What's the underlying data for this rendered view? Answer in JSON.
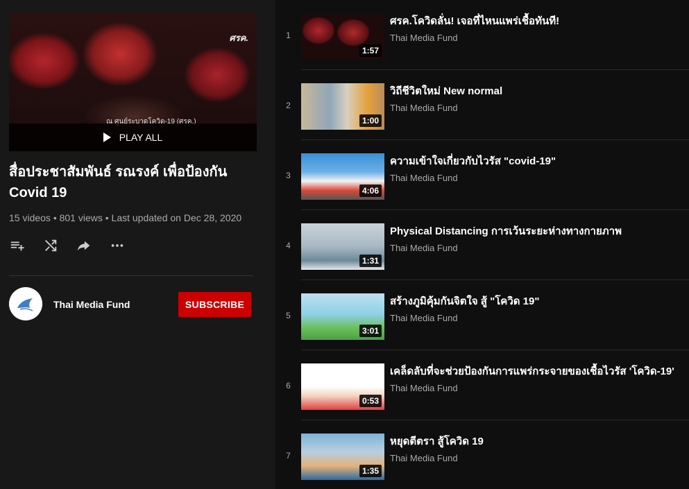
{
  "playlist": {
    "title": "สื่อประชาสัมพันธ์ รณรงค์ เพื่อป้องกัน Covid 19",
    "stats": "15 videos • 801 views • Last updated on Dec 28, 2020",
    "play_all": "PLAY ALL",
    "hero_logo": "ศรค.",
    "hero_caption": "ณ ศูนย์ระบาดโควิด-19 (ศรค.)"
  },
  "actions": {
    "save_icon": "playlist-add-icon",
    "shuffle_icon": "shuffle-icon",
    "share_icon": "share-icon",
    "more_icon": "more-horiz-icon"
  },
  "channel": {
    "name": "Thai Media Fund",
    "subscribe_label": "SUBSCRIBE"
  },
  "videos": [
    {
      "index": "1",
      "title": "ศรค.โควิดลั่น! เจอที่ไหนแพร่เชื้อทันที!",
      "channel": "Thai Media Fund",
      "duration": "1:57"
    },
    {
      "index": "2",
      "title": "วิถีชีวิตใหม่ New normal",
      "channel": "Thai Media Fund",
      "duration": "1:00"
    },
    {
      "index": "3",
      "title": "ความเข้าใจเกี่ยวกับไวรัส \"covid-19\"",
      "channel": "Thai Media Fund",
      "duration": "4:06"
    },
    {
      "index": "4",
      "title": "Physical Distancing การเว้นระยะห่างทางกายภาพ",
      "channel": "Thai Media Fund",
      "duration": "1:31"
    },
    {
      "index": "5",
      "title": "สร้างภูมิคุ้มกันจิตใจ สู้ \"โควิด 19\"",
      "channel": "Thai Media Fund",
      "duration": "3:01"
    },
    {
      "index": "6",
      "title": "เคล็ดลับที่จะช่วยป้องกันการแพร่กระจายของเชื้อไวรัส 'โควิด-19'",
      "channel": "Thai Media Fund",
      "duration": "0:53"
    },
    {
      "index": "7",
      "title": "หยุดตีตรา สู้โควิด 19",
      "channel": "Thai Media Fund",
      "duration": "1:35"
    }
  ],
  "colors": {
    "background": "#181818",
    "list_background": "#0f0f0f",
    "subscribe": "#cc0000",
    "secondary_text": "#aaaaaa"
  }
}
